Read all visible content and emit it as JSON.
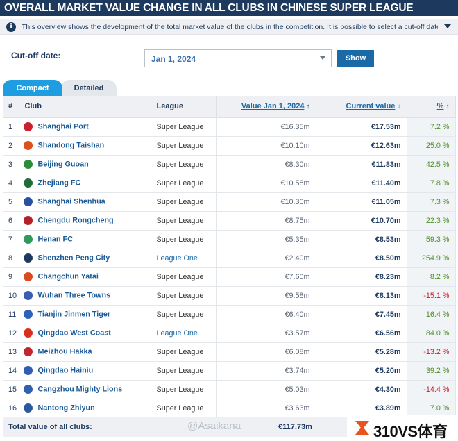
{
  "header": {
    "title": "OVERALL MARKET VALUE CHANGE IN ALL CLUBS IN CHINESE SUPER LEAGUE"
  },
  "info": {
    "icon": "info-icon",
    "text": "This overview shows the development of the total market value of the clubs in the competition. It is possible to select a cut-off date to compa..."
  },
  "filter": {
    "label": "Cut-off date:",
    "selected": "Jan 1, 2024",
    "show_label": "Show"
  },
  "tabs": [
    {
      "label": "Compact",
      "active": true
    },
    {
      "label": "Detailed",
      "active": false
    }
  ],
  "columns": {
    "rank": "#",
    "club": "Club",
    "league": "League",
    "value": "Value Jan 1, 2024",
    "current": "Current value",
    "pct": "%"
  },
  "rows": [
    {
      "rank": "1",
      "club": "Shanghai Port",
      "league": "Super League",
      "value": "€16.35m",
      "current": "€17.53m",
      "pct": "7.2 %",
      "crest": "#c8202c"
    },
    {
      "rank": "2",
      "club": "Shandong Taishan",
      "league": "Super League",
      "value": "€10.10m",
      "current": "€12.63m",
      "pct": "25.0 %",
      "crest": "#d9531e"
    },
    {
      "rank": "3",
      "club": "Beijing Guoan",
      "league": "Super League",
      "value": "€8.30m",
      "current": "€11.83m",
      "pct": "42.5 %",
      "crest": "#2e8b3a"
    },
    {
      "rank": "4",
      "club": "Zhejiang FC",
      "league": "Super League",
      "value": "€10.58m",
      "current": "€11.40m",
      "pct": "7.8 %",
      "crest": "#1f6b3a"
    },
    {
      "rank": "5",
      "club": "Shanghai Shenhua",
      "league": "Super League",
      "value": "€10.30m",
      "current": "€11.05m",
      "pct": "7.3 %",
      "crest": "#2b4fa3"
    },
    {
      "rank": "6",
      "club": "Chengdu Rongcheng",
      "league": "Super League",
      "value": "€8.75m",
      "current": "€10.70m",
      "pct": "22.3 %",
      "crest": "#b3202a"
    },
    {
      "rank": "7",
      "club": "Henan FC",
      "league": "Super League",
      "value": "€5.35m",
      "current": "€8.53m",
      "pct": "59.3 %",
      "crest": "#2e9b5a"
    },
    {
      "rank": "8",
      "club": "Shenzhen Peng City",
      "league": "League One",
      "value": "€2.40m",
      "current": "€8.50m",
      "pct": "254.9 %",
      "crest": "#1d3a5e"
    },
    {
      "rank": "9",
      "club": "Changchun Yatai",
      "league": "Super League",
      "value": "€7.60m",
      "current": "€8.23m",
      "pct": "8.2 %",
      "crest": "#d94a1e"
    },
    {
      "rank": "10",
      "club": "Wuhan Three Towns",
      "league": "Super League",
      "value": "€9.58m",
      "current": "€8.13m",
      "pct": "-15.1 %",
      "crest": "#3a5fb0"
    },
    {
      "rank": "11",
      "club": "Tianjin Jinmen Tiger",
      "league": "Super League",
      "value": "€6.40m",
      "current": "€7.45m",
      "pct": "16.4 %",
      "crest": "#2f63b8"
    },
    {
      "rank": "12",
      "club": "Qingdao West Coast",
      "league": "League One",
      "value": "€3.57m",
      "current": "€6.56m",
      "pct": "84.0 %",
      "crest": "#d9301e"
    },
    {
      "rank": "13",
      "club": "Meizhou Hakka",
      "league": "Super League",
      "value": "€6.08m",
      "current": "€5.28m",
      "pct": "-13.2 %",
      "crest": "#c0262e"
    },
    {
      "rank": "14",
      "club": "Qingdao Hainiu",
      "league": "Super League",
      "value": "€3.74m",
      "current": "€5.20m",
      "pct": "39.2 %",
      "crest": "#2f5fb5"
    },
    {
      "rank": "15",
      "club": "Cangzhou Mighty Lions",
      "league": "Super League",
      "value": "€5.03m",
      "current": "€4.30m",
      "pct": "-14.4 %",
      "crest": "#3060b0"
    },
    {
      "rank": "16",
      "club": "Nantong Zhiyun",
      "league": "Super League",
      "value": "€3.63m",
      "current": "€3.89m",
      "pct": "7.0 %",
      "crest": "#2a5a9e"
    }
  ],
  "total": {
    "label": "Total value of all clubs:",
    "value": "€117.73m"
  },
  "watermark": "@Asaikana",
  "brand": {
    "text": "310VS体育"
  }
}
